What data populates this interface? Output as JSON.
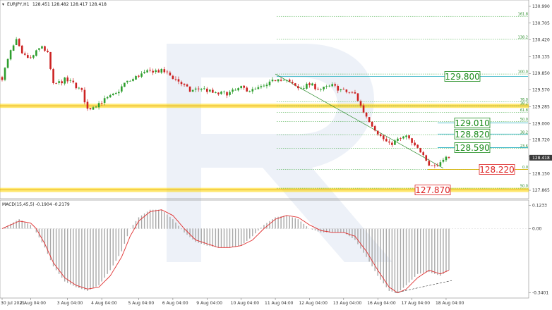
{
  "header": {
    "symbol_title": "EURJPY,H1",
    "ohlc": "128.451 128.482 128.417 128.418"
  },
  "chart_data": [
    {
      "type": "candlestick",
      "price_axis": {
        "ylim": [
          127.77,
          131.05
        ],
        "ticks": [
          "130.990",
          "130.705",
          "130.420",
          "130.135",
          "129.850",
          "129.570",
          "129.285",
          "129.000",
          "128.720",
          "128.435",
          "128.150",
          "127.865"
        ],
        "tick_values": [
          130.99,
          130.705,
          130.42,
          130.135,
          129.85,
          129.57,
          129.285,
          129.0,
          128.72,
          128.435,
          128.15,
          127.865
        ],
        "current_price_label": "128.418",
        "current_price": 128.418
      },
      "x_axis": {
        "ticks": [
          "30 Jul 2021",
          "2 Aug 04:00",
          "3 Aug 04:00",
          "4 Aug 04:00",
          "5 Aug 04:00",
          "6 Aug 04:00",
          "9 Aug 04:00",
          "10 Aug 04:00",
          "11 Aug 04:00",
          "12 Aug 04:00",
          "13 Aug 04:00",
          "16 Aug 04:00",
          "17 Aug 04:00",
          "18 Aug 04:00"
        ],
        "tick_bar_index": [
          0,
          10,
          23,
          35,
          48,
          60,
          72,
          84,
          96,
          108,
          120,
          132,
          144,
          156
        ],
        "bar_count": 158
      },
      "close_path": [
        [
          0,
          129.78
        ],
        [
          3,
          130.22
        ],
        [
          5,
          130.4
        ],
        [
          7,
          130.16
        ],
        [
          10,
          130.1
        ],
        [
          14,
          130.32
        ],
        [
          16,
          130.18
        ],
        [
          18,
          129.65
        ],
        [
          22,
          129.74
        ],
        [
          25,
          129.68
        ],
        [
          28,
          129.54
        ],
        [
          30,
          129.24
        ],
        [
          33,
          129.32
        ],
        [
          36,
          129.4
        ],
        [
          40,
          129.5
        ],
        [
          43,
          129.68
        ],
        [
          46,
          129.75
        ],
        [
          48,
          129.82
        ],
        [
          53,
          129.9
        ],
        [
          57,
          129.88
        ],
        [
          62,
          129.72
        ],
        [
          66,
          129.55
        ],
        [
          70,
          129.6
        ],
        [
          75,
          129.5
        ],
        [
          80,
          129.52
        ],
        [
          84,
          129.6
        ],
        [
          88,
          129.56
        ],
        [
          93,
          129.64
        ],
        [
          97,
          129.78
        ],
        [
          100,
          129.72
        ],
        [
          104,
          129.6
        ],
        [
          108,
          129.66
        ],
        [
          112,
          129.58
        ],
        [
          116,
          129.64
        ],
        [
          120,
          129.55
        ],
        [
          124,
          129.5
        ],
        [
          127,
          129.2
        ],
        [
          130,
          128.98
        ],
        [
          133,
          128.78
        ],
        [
          136,
          128.64
        ],
        [
          139,
          128.72
        ],
        [
          142,
          128.78
        ],
        [
          145,
          128.6
        ],
        [
          148,
          128.5
        ],
        [
          150,
          128.3
        ],
        [
          153,
          128.28
        ],
        [
          155,
          128.42
        ],
        [
          157,
          128.42
        ]
      ],
      "horizontal_lines": [
        {
          "value": 129.3,
          "color": "#ffd700",
          "style": "band"
        },
        {
          "value": 127.87,
          "color": "#ffd700",
          "style": "band"
        },
        {
          "value": 129.8,
          "color": "#3fb8c8",
          "style": "solid"
        },
        {
          "value": 129.01,
          "color": "#3fb8c8",
          "style": "solid"
        },
        {
          "value": 128.82,
          "color": "#3fb8c8",
          "style": "solid"
        },
        {
          "value": 128.59,
          "color": "#3fb8c8",
          "style": "solid"
        },
        {
          "value": 128.22,
          "color": "#d4b000",
          "style": "solid"
        }
      ],
      "fib_levels": [
        {
          "label": "161.8",
          "value": 130.82
        },
        {
          "label": "138.2",
          "value": 130.43
        },
        {
          "label": "100.0",
          "value": 129.84
        },
        {
          "label": "76.0",
          "value": 129.37
        },
        {
          "label": "38.2",
          "value": 129.3
        },
        {
          "label": "61.8",
          "value": 129.19
        },
        {
          "label": "50.0",
          "value": 129.03
        },
        {
          "label": "38.2",
          "value": 128.81
        },
        {
          "label": "23.6",
          "value": 128.58
        },
        {
          "label": "0.0",
          "value": 128.22
        },
        {
          "label": "50.0",
          "value": 127.9
        }
      ],
      "annotations": [
        {
          "text": "129.800",
          "value": 129.8,
          "color": "#1a8a1a"
        },
        {
          "text": "129.010",
          "value": 129.01,
          "color": "#1a8a1a"
        },
        {
          "text": "128.820",
          "value": 128.82,
          "color": "#1a8a1a"
        },
        {
          "text": "128.590",
          "value": 128.59,
          "color": "#1a8a1a"
        },
        {
          "text": "128.220",
          "value": 128.22,
          "color": "#dd2222"
        },
        {
          "text": "127.870",
          "value": 127.87,
          "color": "#dd2222"
        }
      ],
      "trend_line": {
        "from": [
          96,
          129.84
        ],
        "to": [
          155,
          128.24
        ],
        "color": "#2a8a2a"
      }
    },
    {
      "type": "macd",
      "title": "MACD(15,45,5) -0.1904 -0.2179",
      "ylim": [
        -0.36,
        0.14
      ],
      "ticks": [
        "0.1233",
        "0.00",
        "-0.3401"
      ],
      "tick_values": [
        0.1233,
        0.0,
        -0.3401
      ],
      "histogram_path": [
        [
          0,
          0.0
        ],
        [
          6,
          0.05
        ],
        [
          10,
          0.02
        ],
        [
          12,
          -0.02
        ],
        [
          15,
          -0.1
        ],
        [
          18,
          -0.2
        ],
        [
          22,
          -0.28
        ],
        [
          26,
          -0.31
        ],
        [
          30,
          -0.33
        ],
        [
          34,
          -0.3
        ],
        [
          38,
          -0.22
        ],
        [
          42,
          -0.12
        ],
        [
          45,
          0.0
        ],
        [
          48,
          0.06
        ],
        [
          52,
          0.1
        ],
        [
          56,
          0.1
        ],
        [
          60,
          0.05
        ],
        [
          64,
          -0.02
        ],
        [
          68,
          -0.07
        ],
        [
          72,
          -0.09
        ],
        [
          76,
          -0.1
        ],
        [
          80,
          -0.1
        ],
        [
          84,
          -0.09
        ],
        [
          88,
          -0.04
        ],
        [
          92,
          0.02
        ],
        [
          96,
          0.06
        ],
        [
          100,
          0.07
        ],
        [
          104,
          0.05
        ],
        [
          108,
          0.0
        ],
        [
          112,
          -0.02
        ],
        [
          116,
          -0.02
        ],
        [
          120,
          -0.02
        ],
        [
          124,
          -0.06
        ],
        [
          128,
          -0.15
        ],
        [
          132,
          -0.25
        ],
        [
          136,
          -0.33
        ],
        [
          139,
          -0.34
        ],
        [
          142,
          -0.3
        ],
        [
          146,
          -0.24
        ],
        [
          150,
          -0.23
        ],
        [
          154,
          -0.25
        ],
        [
          157,
          -0.22
        ]
      ],
      "signal_path": [
        [
          0,
          0.0
        ],
        [
          6,
          0.04
        ],
        [
          10,
          0.03
        ],
        [
          12,
          0.0
        ],
        [
          15,
          -0.08
        ],
        [
          18,
          -0.18
        ],
        [
          22,
          -0.26
        ],
        [
          26,
          -0.3
        ],
        [
          30,
          -0.32
        ],
        [
          34,
          -0.31
        ],
        [
          38,
          -0.25
        ],
        [
          42,
          -0.15
        ],
        [
          45,
          -0.04
        ],
        [
          48,
          0.04
        ],
        [
          52,
          0.09
        ],
        [
          56,
          0.1
        ],
        [
          60,
          0.07
        ],
        [
          64,
          0.0
        ],
        [
          68,
          -0.06
        ],
        [
          72,
          -0.08
        ],
        [
          76,
          -0.1
        ],
        [
          80,
          -0.1
        ],
        [
          84,
          -0.09
        ],
        [
          88,
          -0.06
        ],
        [
          92,
          0.0
        ],
        [
          96,
          0.05
        ],
        [
          100,
          0.07
        ],
        [
          104,
          0.06
        ],
        [
          108,
          0.02
        ],
        [
          112,
          -0.01
        ],
        [
          116,
          -0.02
        ],
        [
          120,
          -0.02
        ],
        [
          124,
          -0.04
        ],
        [
          128,
          -0.12
        ],
        [
          132,
          -0.22
        ],
        [
          136,
          -0.31
        ],
        [
          139,
          -0.34
        ],
        [
          142,
          -0.32
        ],
        [
          146,
          -0.26
        ],
        [
          150,
          -0.22
        ],
        [
          154,
          -0.24
        ],
        [
          157,
          -0.22
        ]
      ],
      "divergence_line": {
        "from": [
          138,
          -0.34
        ],
        "to": [
          158,
          -0.275
        ]
      }
    }
  ],
  "colors": {
    "bull": "#2e9e2e",
    "bear": "#cc2222",
    "signal": "#e03030",
    "histogram": "#a8a8a8",
    "fib": "#2aa02a",
    "watermark": "#dfe5f2"
  }
}
